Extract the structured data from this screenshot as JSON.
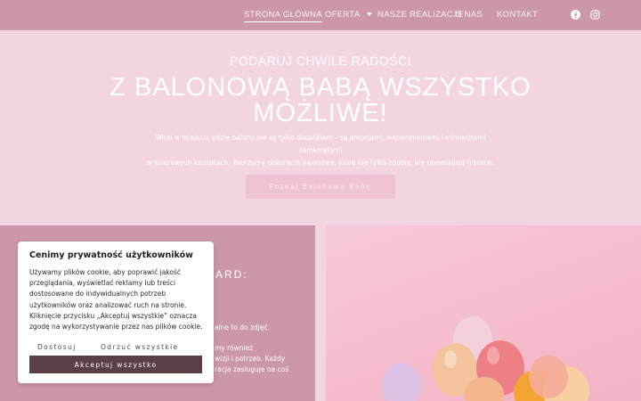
{
  "nav": {
    "items": [
      {
        "label": "STRONA GŁÓWNA"
      },
      {
        "label": "OFERTA"
      },
      {
        "label": "NASZE REALIZACJE"
      },
      {
        "label": "O NAS"
      },
      {
        "label": "KONTAKT"
      }
    ],
    "social": [
      "facebook-icon",
      "instagram-icon"
    ]
  },
  "hero": {
    "subtitle": "PODARUJ CHWILE RADOŚCI",
    "title_line1": "Z BALONOWĄ BABĄ WSZYSTKO",
    "title_line2": "MOŻLIWE!",
    "text_line1": "Witaj w miejscu, gdzie balony nie są tylko dodatkiem – są emocjami, wspomnieniami i uśmiechami zamkniętymi",
    "text_line2": "w kolorowych kształtach. Tworzymy dekoracje balonowe, które nie tylko zdobią, ale opowiadają historie.",
    "button_label": "Poznaj Balonową Babę"
  },
  "left_section": {
    "heading_fragment": "ARD:",
    "p1": "alne to do zdjęć.",
    "p2": "my również",
    "p3": "wizji i potrzeb. Każdy",
    "p4": "racja zasługuje na coś"
  },
  "cookie": {
    "title": "Cenimy prywatność użytkowników",
    "body": [
      "Używamy plików cookie, aby poprawić jakość",
      "przeglądania, wyświetlać reklamy lub treści",
      "dostosowane do indywidualnych potrzeb",
      "użytkowników oraz analizować ruch na stronie.",
      "Kliknięcie przycisku „Akceptuj wszystkie” oznacza",
      "zgodę na wykorzystywanie przez nas plików cookie."
    ],
    "customize_label": "Dostosuj",
    "reject_label": "Odrzuć wszystkie",
    "accept_label": "Akceptuj wszystko"
  },
  "colors": {
    "nav_bg": "#cc97a8",
    "hero_bg": "#f3d4e3",
    "accept_bg": "#5a3f45"
  }
}
